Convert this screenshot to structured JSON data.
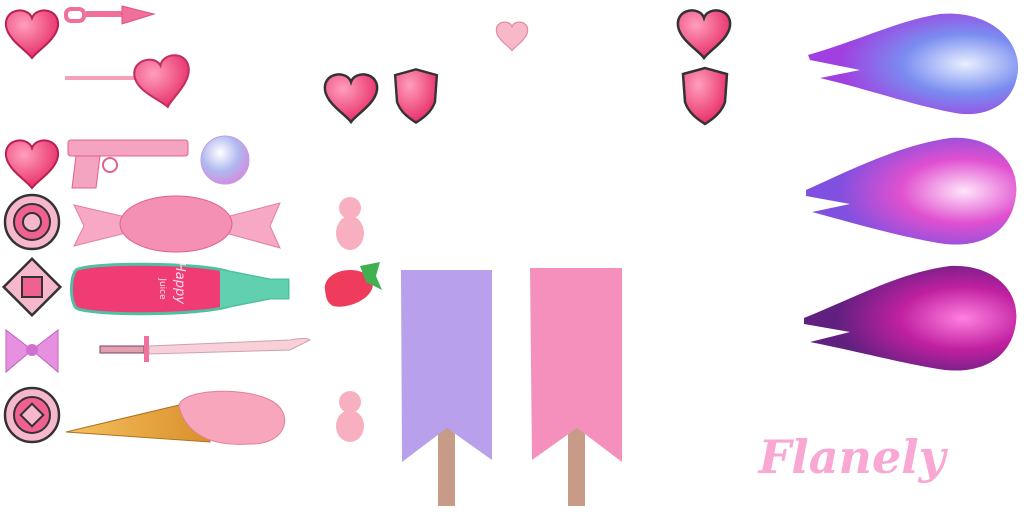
{
  "sheet": {
    "logo_text": "Flanely",
    "bottle_label": {
      "line1": "Happy",
      "line2": "Juice"
    },
    "colors": {
      "pink": "#f0527e",
      "light_pink": "#f9a8c8",
      "purple": "#b39ae8",
      "logo": "#f9a8d4"
    },
    "sprites": [
      "heart-icon",
      "chain-arrow-icon",
      "heart-lollipop-icon",
      "heart-icon",
      "shield-icon",
      "small-heart-icon",
      "heart-icon",
      "shield-icon",
      "fireball-blue",
      "fireball-pink",
      "fireball-magenta",
      "heart-icon",
      "pink-gun-icon",
      "disco-ball-icon",
      "target-icon",
      "candy-icon",
      "gummy-bear-icon",
      "diamond-target-icon",
      "juice-bottle-icon",
      "strawberry-icon",
      "bow-icon",
      "katana-icon",
      "emblem-icon",
      "ice-cream-icon",
      "gummy-bear-icon",
      "purple-banner",
      "pink-banner"
    ]
  }
}
